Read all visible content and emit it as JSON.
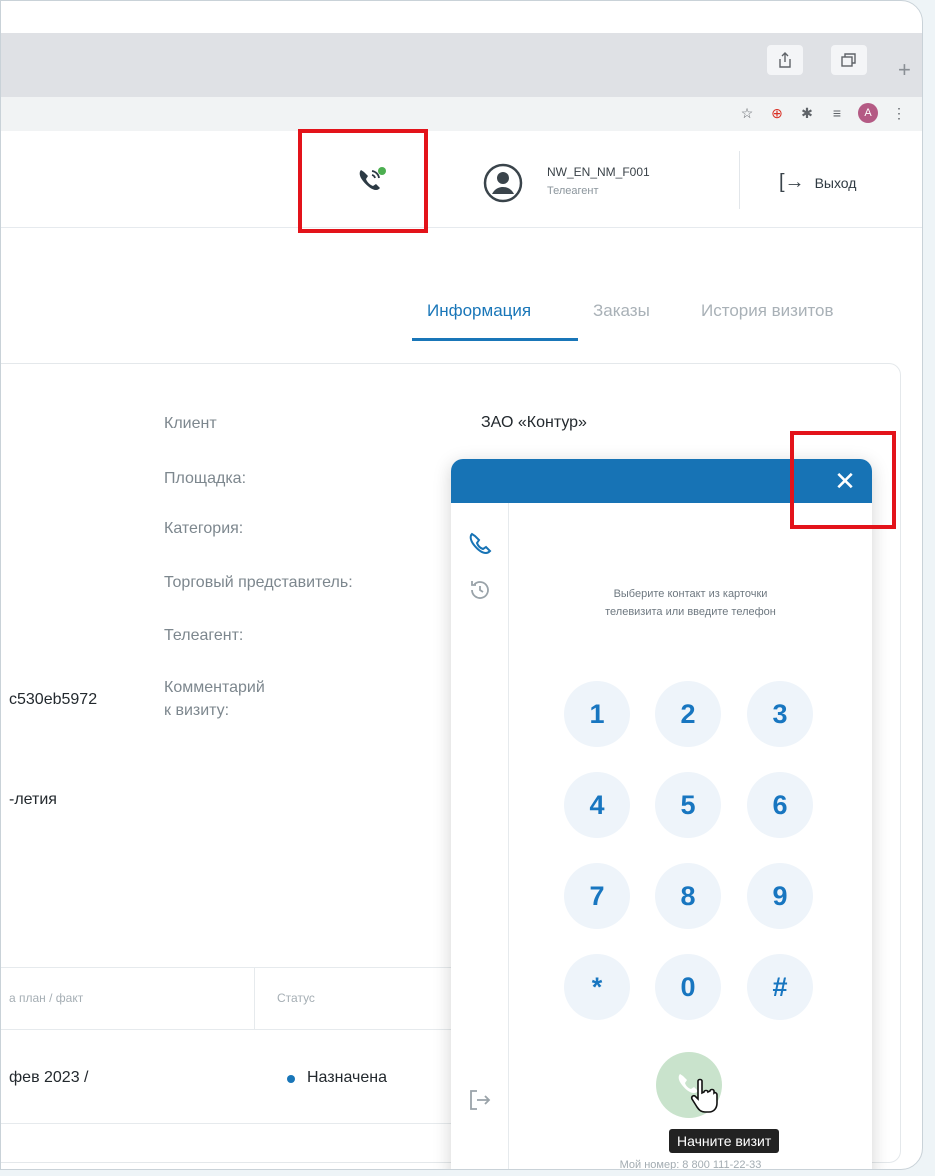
{
  "browser": {
    "icons": [
      "share-icon",
      "window-icon",
      "plus-icon",
      "star-icon",
      "extension-red-icon",
      "puzzle-icon",
      "playlist-icon",
      "profile-icon",
      "menu-icon"
    ],
    "profile_initial": "A"
  },
  "header": {
    "user": {
      "name": "NW_EN_NM_F001",
      "role": "Телеагент"
    },
    "logout_label": "Выход"
  },
  "tabs": [
    {
      "label": "Информация",
      "active": true
    },
    {
      "label": "Заказы",
      "active": false
    },
    {
      "label": "История визитов",
      "active": false
    }
  ],
  "info": {
    "labels": {
      "client": "Клиент",
      "site": "Площадка:",
      "category": "Категория:",
      "sales_rep": "Торговый представитель:",
      "teleagent": "Телеагент:",
      "comment_line1": "Комментарий",
      "comment_line2": "к визиту:"
    },
    "client_value": "ЗАО «Контур»",
    "left_fragments": {
      "id": "c530eb5972",
      "address": "-летия"
    }
  },
  "table": {
    "headers": {
      "date": "а план / факт",
      "status": "Статус"
    },
    "row": {
      "date": "фев 2023 /",
      "status": "Назначена"
    }
  },
  "dialer": {
    "hint_line1": "Выберите контакт из карточки",
    "hint_line2": "телевизита или введите телефон",
    "keys": [
      "1",
      "2",
      "3",
      "4",
      "5",
      "6",
      "7",
      "8",
      "9",
      "*",
      "0",
      "#"
    ],
    "tooltip": "Начните визит",
    "my_number": "Мой номер: 8 800 111-22-33"
  },
  "colors": {
    "accent": "#1976b8",
    "dialer_header": "#1773b5",
    "highlight": "#e3131a",
    "online_dot": "#4caf50",
    "call_button": "#c9e3cc"
  }
}
